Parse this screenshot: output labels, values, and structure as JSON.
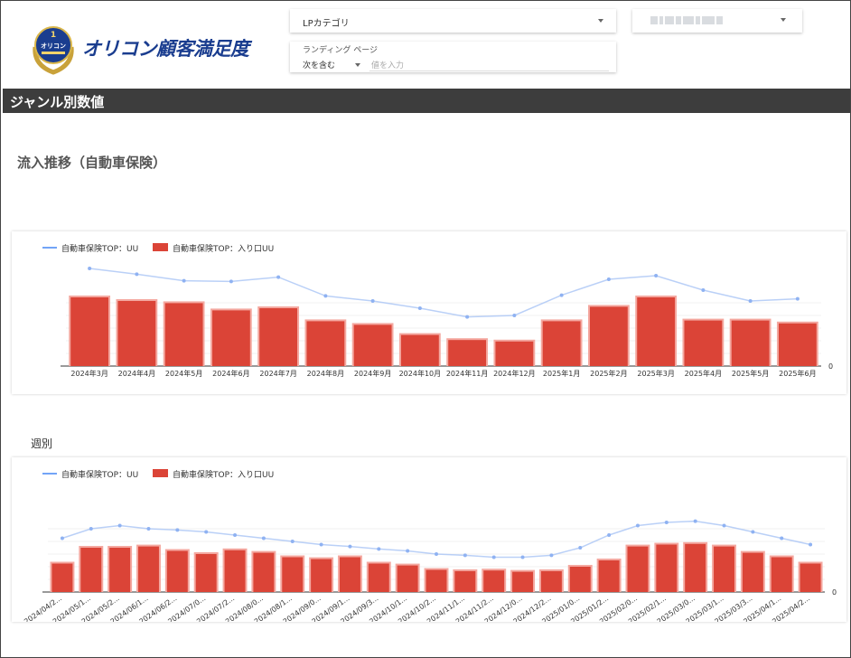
{
  "header": {
    "logo": {
      "text": "オリコン顧客満足度",
      "badge_rank": "1",
      "badge_text": "オリコン"
    },
    "filters": {
      "lp_category": {
        "label": "LPカテゴリ"
      },
      "landing_page": {
        "label": "ランディング ページ",
        "operator": "次を含む",
        "placeholder": "値を入力"
      }
    }
  },
  "genre_bar": {
    "title": "ジャンル別数値"
  },
  "monthly": {
    "title": "流入推移（自動車保険）",
    "legend": {
      "line": "自動車保険TOP：UU",
      "bar": "自動車保険TOP：入り口UU"
    }
  },
  "weekly": {
    "title": "週別",
    "legend": {
      "line": "自動車保険TOP：UU",
      "bar": "自動車保険TOP：入り口UU"
    }
  },
  "colors": {
    "bar": "#db4437",
    "line": "#4285f4",
    "header_bar": "#3d3d3d",
    "logo": "#1a3d8f"
  },
  "chart_data": [
    {
      "type": "bar",
      "title": "流入推移（自動車保険）",
      "categories": [
        "2024年3月",
        "2024年4月",
        "2024年5月",
        "2024年6月",
        "2024年7月",
        "2024年8月",
        "2024年9月",
        "2024年10月",
        "2024年11月",
        "2024年12月",
        "2025年1月",
        "2025年2月",
        "2025年3月",
        "2025年4月",
        "2025年5月",
        "2025年6月"
      ],
      "series": [
        {
          "name": "自動車保険TOP：入り口UU",
          "type": "bar",
          "values": [
            0.95,
            0.9,
            0.87,
            0.77,
            0.8,
            0.62,
            0.57,
            0.43,
            0.36,
            0.34,
            0.62,
            0.82,
            0.95,
            0.63,
            0.63,
            0.59
          ]
        },
        {
          "name": "自動車保険TOP：UU",
          "type": "line",
          "values": [
            1.35,
            1.27,
            1.18,
            1.17,
            1.23,
            0.97,
            0.9,
            0.8,
            0.68,
            0.7,
            0.98,
            1.2,
            1.25,
            1.05,
            0.9,
            0.93
          ]
        }
      ],
      "y_axis": {
        "min_label": "0",
        "tick_labels_visible": false
      },
      "legend": "top-left"
    },
    {
      "type": "bar",
      "title": "週別",
      "categories": [
        "2024/04/2...",
        "2024/05/1...",
        "2024/05/2...",
        "2024/06/1...",
        "2024/06/2...",
        "2024/07/0...",
        "2024/07/2...",
        "2024/08/0...",
        "2024/08/1...",
        "2024/09/0...",
        "2024/09/1...",
        "2024/09/3...",
        "2024/10/1...",
        "2024/10/2...",
        "2024/11/1...",
        "2024/11/2...",
        "2024/12/0...",
        "2024/12/2...",
        "2025/01/0...",
        "2025/01/2...",
        "2025/02/0...",
        "2025/02/1...",
        "2025/03/0...",
        "2025/03/1...",
        "2025/03/3...",
        "2025/04/1...",
        "2025/04/2..."
      ],
      "series": [
        {
          "name": "自動車保険TOP：入り口UU",
          "type": "bar",
          "values": [
            0.45,
            0.7,
            0.7,
            0.72,
            0.65,
            0.6,
            0.66,
            0.62,
            0.55,
            0.52,
            0.55,
            0.45,
            0.42,
            0.35,
            0.33,
            0.34,
            0.32,
            0.33,
            0.4,
            0.5,
            0.72,
            0.75,
            0.76,
            0.72,
            0.62,
            0.55,
            0.45
          ]
        },
        {
          "name": "自動車保険TOP：UU",
          "type": "line",
          "values": [
            0.85,
            1.0,
            1.05,
            1.0,
            0.98,
            0.95,
            0.9,
            0.85,
            0.8,
            0.75,
            0.72,
            0.68,
            0.65,
            0.6,
            0.58,
            0.55,
            0.55,
            0.58,
            0.7,
            0.9,
            1.05,
            1.1,
            1.12,
            1.05,
            0.95,
            0.85,
            0.75
          ]
        }
      ],
      "y_axis": {
        "min_label": "0",
        "tick_labels_visible": false
      },
      "legend": "top-left"
    }
  ]
}
